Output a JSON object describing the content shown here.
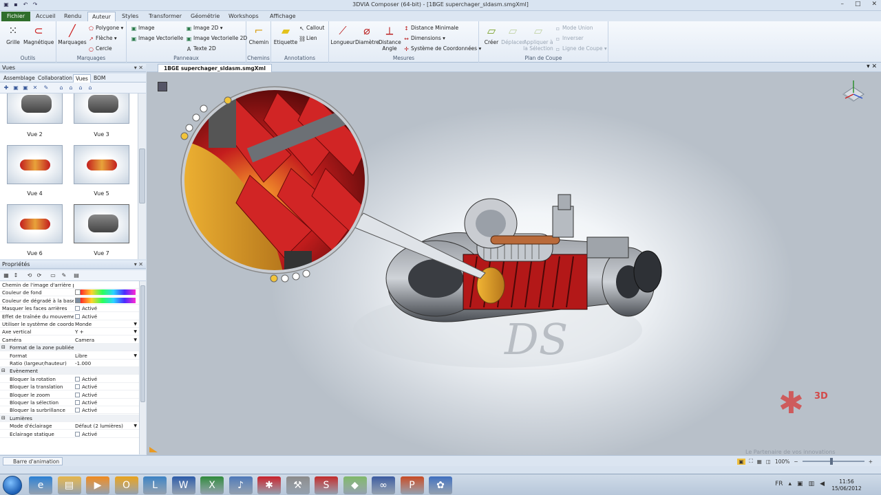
{
  "window": {
    "title": "3DVIA Composer (64-bit) - [1BGE superchager_sldasm.smgXml]",
    "controls": [
      "–",
      "□",
      "✕"
    ]
  },
  "ribbon_tabs": [
    {
      "label": "Fichier",
      "kind": "file"
    },
    {
      "label": "Accueil"
    },
    {
      "label": "Rendu"
    },
    {
      "label": "Auteur",
      "active": true
    },
    {
      "label": "Styles"
    },
    {
      "label": "Transformer"
    },
    {
      "label": "Géométrie"
    },
    {
      "label": "Workshops"
    },
    {
      "label": "Affichage"
    }
  ],
  "ribbon": {
    "outils": {
      "label": "Outils",
      "grille": "Grille",
      "magnetique": "Magnétique"
    },
    "marquages": {
      "label": "Marquages",
      "marquages": "Marquages",
      "polygone": "Polygone",
      "fleche": "Flèche",
      "cercle": "Cercle"
    },
    "panneaux": {
      "label": "Panneaux",
      "image": "Image",
      "image_vect": "Image Vectorielle",
      "image2d": "Image 2D",
      "image_vect2d": "Image Vectorielle 2D",
      "texte2d": "Texte 2D"
    },
    "chemins": {
      "label": "Chemins",
      "chemin": "Chemin"
    },
    "annotations": {
      "label": "Annotations",
      "etiquette": "Etiquette",
      "callout": "Callout",
      "lien": "Lien"
    },
    "mesures": {
      "label": "Mesures",
      "longueur": "Longueur",
      "diametre": "Diamètre",
      "distance": "Distance",
      "angle": "Angle",
      "dist_min": "Distance Minimale",
      "dimensions": "Dimensions",
      "systeme": "Système de Coordonnées"
    },
    "plan": {
      "label": "Plan de Coupe",
      "creer": "Créer",
      "deplacer": "Déplacer",
      "appliquer": "Appliquer à",
      "selection": "la Sélection",
      "mode_union": "Mode Union",
      "inverser": "Inverser",
      "ligne": "Ligne de Coupe"
    }
  },
  "vues_panel": {
    "title": "Vues",
    "tabs": [
      {
        "label": "Assemblage"
      },
      {
        "label": "Collaboration"
      },
      {
        "label": "Vues",
        "active": true
      },
      {
        "label": "BOM"
      }
    ],
    "thumbnails": [
      {
        "label": "Vue 2",
        "kind": "engine"
      },
      {
        "label": "Vue 3",
        "kind": "engine"
      },
      {
        "label": "Vue 4",
        "kind": "rotor"
      },
      {
        "label": "Vue 5",
        "kind": "rotor"
      },
      {
        "label": "Vue 6",
        "kind": "rotor"
      },
      {
        "label": "Vue 7",
        "kind": "engine",
        "selected": true
      }
    ]
  },
  "proprietes_panel": {
    "title": "Propriétés",
    "rows": [
      {
        "key": "Chemin de l'image d'arrière plan",
        "value": ""
      },
      {
        "key": "Couleur de fond",
        "value": "",
        "swatch": "#ffffff"
      },
      {
        "key": "Couleur de dégradé à la base",
        "value": "",
        "swatch": "#7d8ea0"
      },
      {
        "key": "Masquer les faces arrières",
        "value": "Activé",
        "check": true
      },
      {
        "key": "Effet de traînée du mouvement",
        "value": "Activé",
        "check": true
      },
      {
        "key": "Utiliser le système de coordon...",
        "value": "Monde",
        "dropdown": true
      },
      {
        "key": "Axe vertical",
        "value": "Y +",
        "dropdown": true
      },
      {
        "key": "Caméra",
        "value": "Camera",
        "dropdown": true
      },
      {
        "key": "Format de la zone publiée",
        "category": true
      },
      {
        "key": "Format",
        "value": "Libre",
        "dropdown": true,
        "indent": true
      },
      {
        "key": "Ratio (largeur/hauteur)",
        "value": "-1.000",
        "indent": true
      },
      {
        "key": "Evènement",
        "category": true
      },
      {
        "key": "Bloquer la rotation",
        "value": "Activé",
        "check": true,
        "indent": true
      },
      {
        "key": "Bloquer la translation",
        "value": "Activé",
        "check": true,
        "indent": true
      },
      {
        "key": "Bloquer le zoom",
        "value": "Activé",
        "check": true,
        "indent": true
      },
      {
        "key": "Bloquer la sélection",
        "value": "Activé",
        "check": true,
        "indent": true
      },
      {
        "key": "Bloquer la surbrillance",
        "value": "Activé",
        "check": true,
        "indent": true
      },
      {
        "key": "Lumières",
        "category": true
      },
      {
        "key": "Mode d'éclairage",
        "value": "Défaut (2 lumières)",
        "dropdown": true,
        "indent": true
      },
      {
        "key": "Eclairage statique",
        "value": "Activé",
        "check": true,
        "indent": true
      }
    ]
  },
  "document": {
    "tab": "1BGE superchager_sldasm.smgXml",
    "watermark": {
      "brand": "3D",
      "tagline": "Le Partenaire de vos innovations"
    }
  },
  "statusbar": {
    "anim_tab": "Barre d'animation",
    "zoom": "100%"
  },
  "taskbar": {
    "lang": "FR",
    "time": "11:56",
    "date": "15/06/2012",
    "apps": [
      {
        "name": "ie-icon",
        "color": "#2a7fd4",
        "glyph": "e"
      },
      {
        "name": "explorer-icon",
        "color": "#e5b54a",
        "glyph": "▤"
      },
      {
        "name": "media-icon",
        "color": "#ef8a1e",
        "glyph": "▶"
      },
      {
        "name": "outlook-icon",
        "color": "#e8a21c",
        "glyph": "O"
      },
      {
        "name": "lync-icon",
        "color": "#3b82c4",
        "glyph": "L"
      },
      {
        "name": "word-icon",
        "color": "#2a5aa8",
        "glyph": "W"
      },
      {
        "name": "excel-icon",
        "color": "#2f8a3c",
        "glyph": "X"
      },
      {
        "name": "itunes-icon",
        "color": "#4d78b8",
        "glyph": "♪"
      },
      {
        "name": "3ds-icon",
        "color": "#c8202a",
        "glyph": "✱"
      },
      {
        "name": "tools-icon",
        "color": "#8a8a8a",
        "glyph": "⚒"
      },
      {
        "name": "solidworks-icon",
        "color": "#c22a2a",
        "glyph": "S"
      },
      {
        "name": "composer-icon",
        "color": "#7fb86a",
        "glyph": "◆"
      },
      {
        "name": "link-icon",
        "color": "#3a5aa0",
        "glyph": "∞"
      },
      {
        "name": "powerpoint-icon",
        "color": "#c74a24",
        "glyph": "P"
      },
      {
        "name": "gear-icon",
        "color": "#3f6fbf",
        "glyph": "✿"
      }
    ]
  }
}
